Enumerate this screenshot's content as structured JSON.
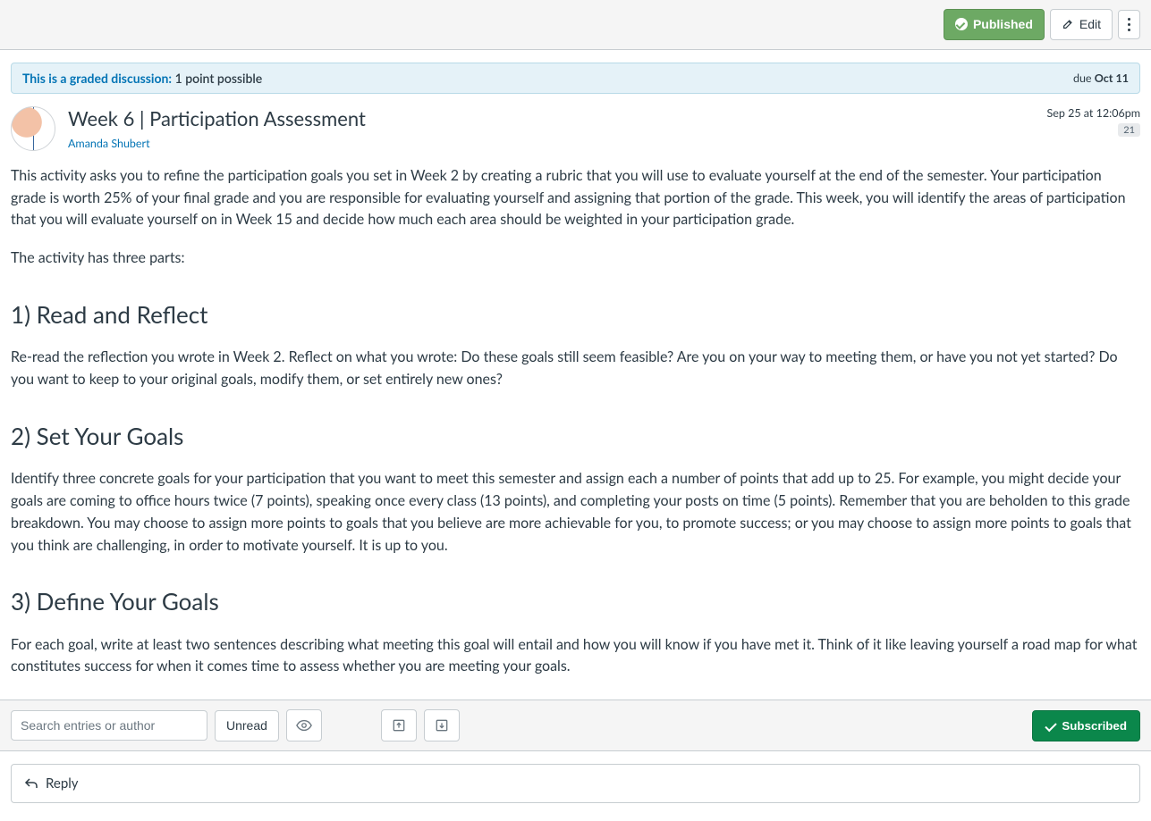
{
  "toolbar": {
    "published_label": "Published",
    "edit_label": "Edit"
  },
  "graded_banner": {
    "prefix": "This is a graded discussion:",
    "points_text": "1 point possible",
    "due_prefix": "due ",
    "due_date": "Oct 11"
  },
  "post": {
    "title": "Week 6 | Participation Assessment",
    "author": "Amanda Shubert",
    "timestamp": "Sep 25 at 12:06pm",
    "count": "21"
  },
  "body": {
    "intro": "This activity asks you to refine the participation goals you set in Week 2 by creating a rubric that you will use to evaluate yourself at the end of the semester. Your participation grade is worth 25% of your final grade and you are responsible for evaluating yourself and assigning that portion of the grade. This week, you will identify the areas of participation that you will evaluate yourself on in Week 15 and decide how much each area should be weighted in your participation grade.",
    "activity_line": "The activity has three parts:",
    "h1": "1) Read and Reflect",
    "p1": "Re-read the reflection you wrote in Week 2. Reflect on what you wrote: Do these goals still seem feasible? Are you on your way to meeting them, or have you not yet started? Do you want to keep to your original goals, modify them, or set entirely new ones?",
    "h2": "2) Set Your Goals",
    "p2": "Identify three concrete goals for your participation that you want to meet this semester and assign each a number of points that add up to 25. For example, you might decide your goals are coming to office hours twice (7 points), speaking once every class (13 points), and completing your posts on time (5 points). Remember that you are beholden to this grade breakdown. You may choose to assign more points to goals that you believe are more achievable for you, to promote success; or you may choose to assign more points to goals that you think are challenging, in order to motivate yourself. It is up to you.",
    "h3": "3) Define Your Goals",
    "p3": "For each goal, write at least two sentences describing what meeting this goal will entail and how you will know if you have met it. Think of it like leaving yourself a road map for what constitutes success for when it comes time to assess whether you are meeting your goals."
  },
  "actionbar": {
    "search_placeholder": "Search entries or author",
    "unread_label": "Unread",
    "subscribed_label": "Subscribed"
  },
  "reply": {
    "label": "Reply"
  }
}
